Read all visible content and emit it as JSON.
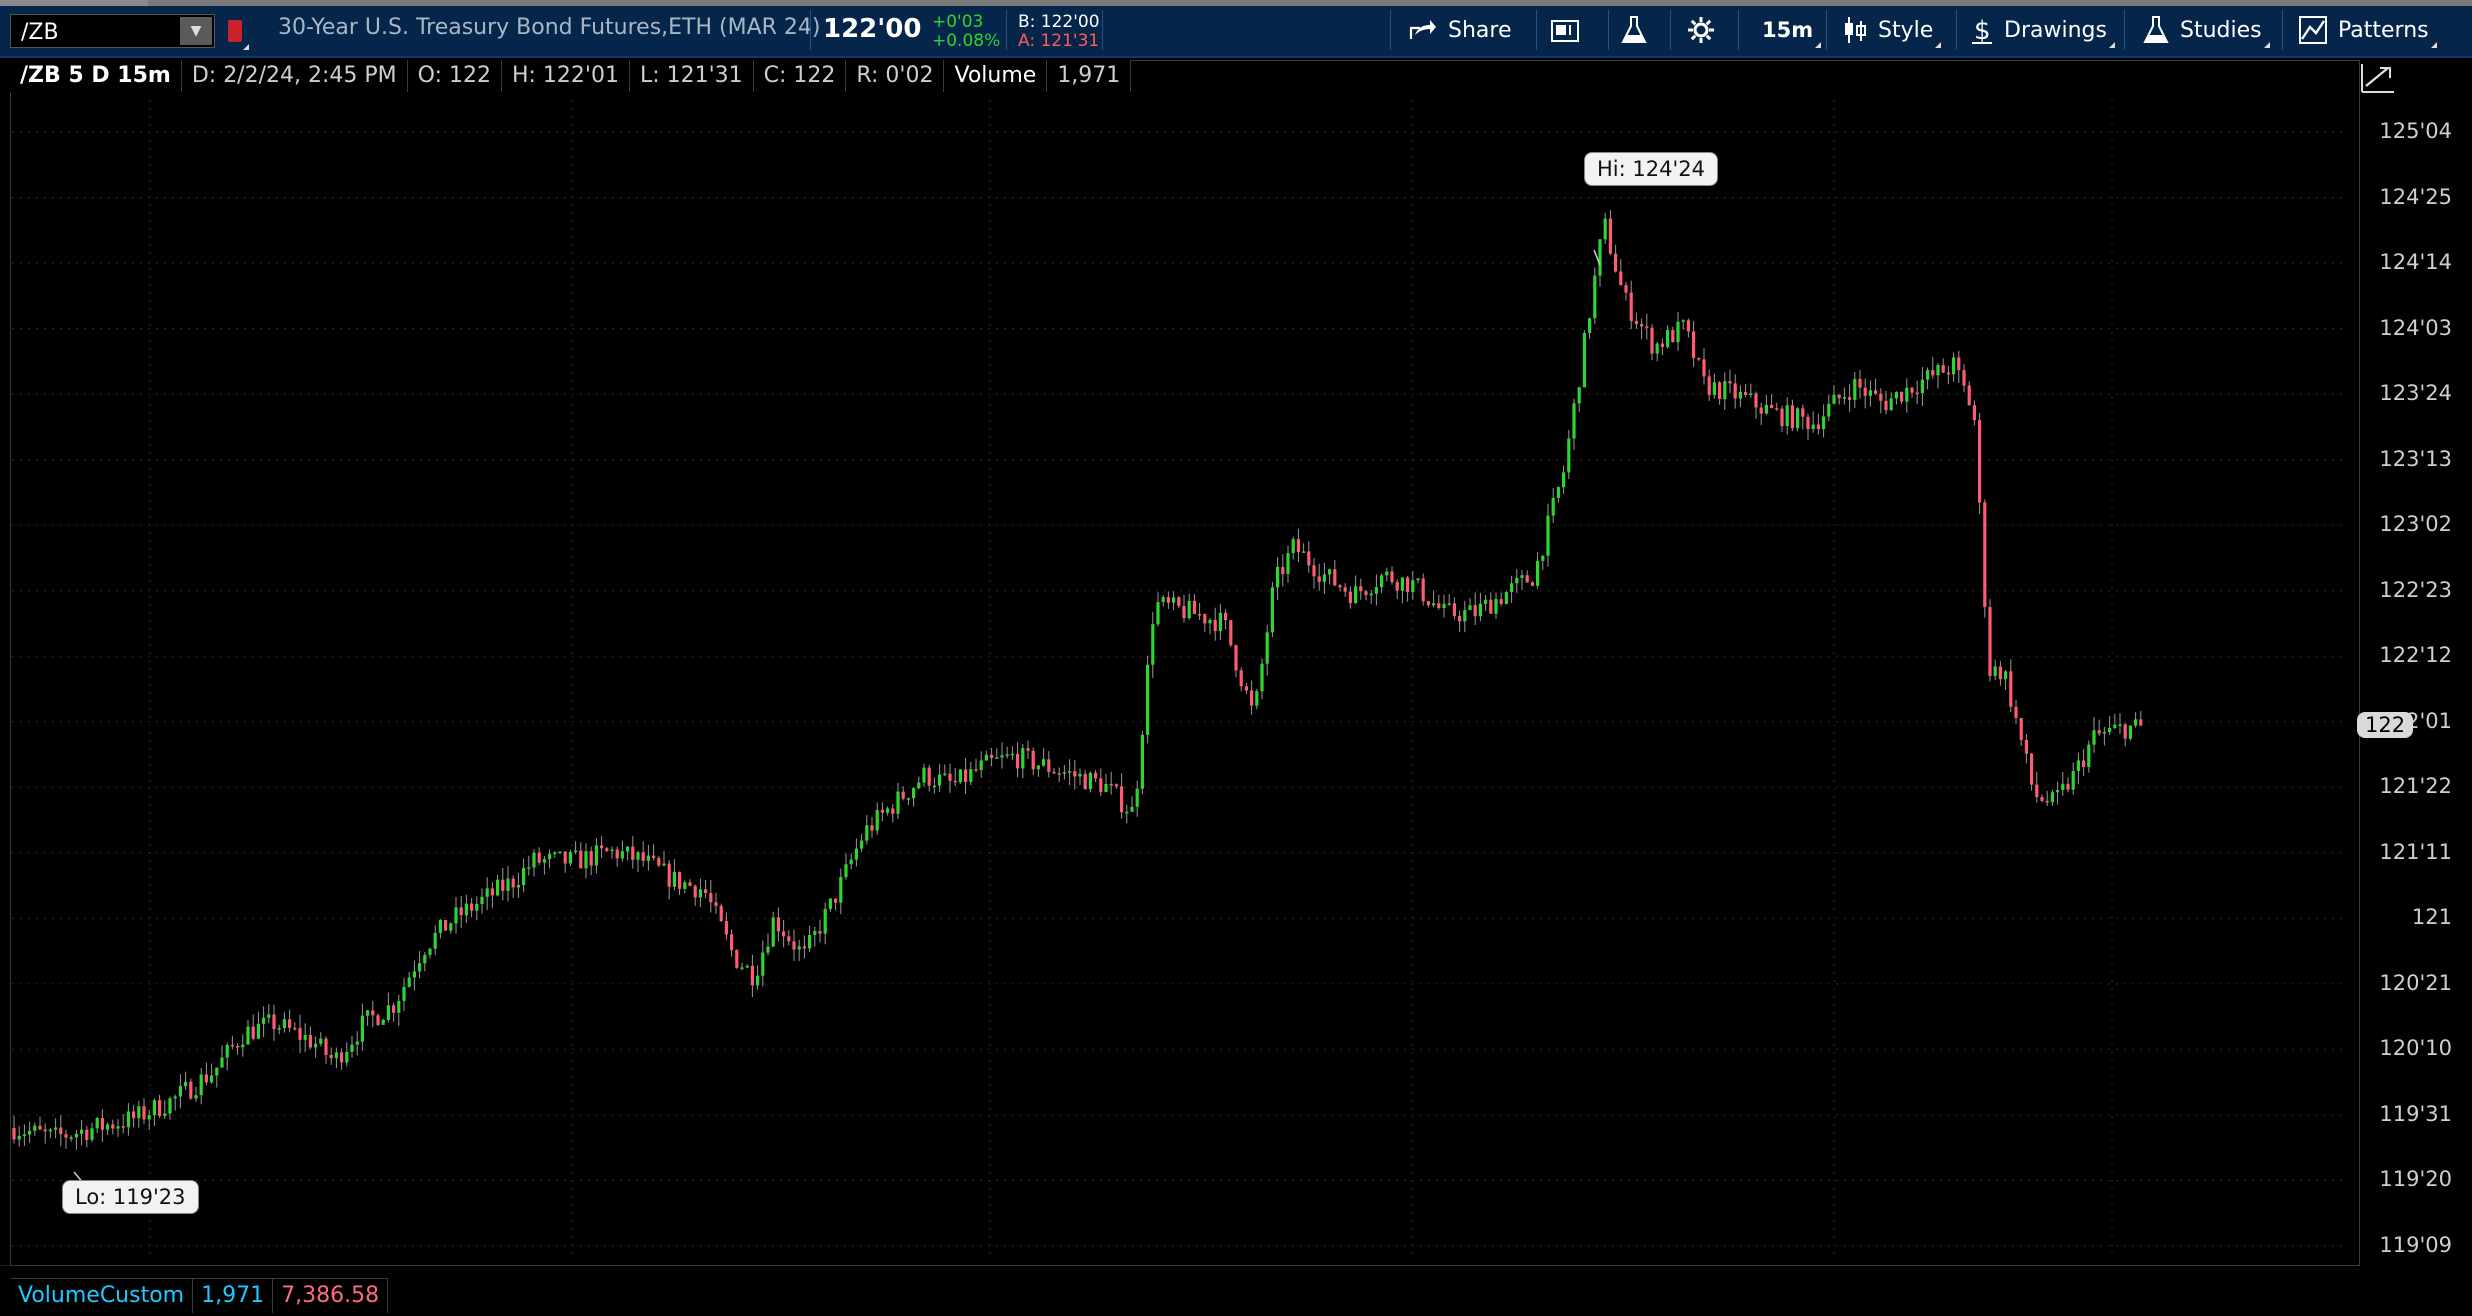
{
  "toolbar": {
    "symbol": "/ZB",
    "instrument": "30-Year U.S. Treasury Bond Futures,ETH (MAR 24)",
    "last_price": "122'00",
    "change_abs": "+0'03",
    "change_pct": "+0.08%",
    "bid": "B: 122'00",
    "ask": "A: 121'31",
    "share_label": "Share",
    "timeframe_label": "15m",
    "style_label": "Style",
    "drawings_label": "Drawings",
    "studies_label": "Studies",
    "patterns_label": "Patterns"
  },
  "chart_header": {
    "title": "/ZB 5 D 15m",
    "date": "D: 2/2/24, 2:45 PM",
    "open": "O: 122",
    "high": "H: 122'01",
    "low": "L: 121'31",
    "close": "C: 122",
    "range": "R: 0'02",
    "volume_label": "Volume",
    "volume_value": "1,971"
  },
  "callouts": {
    "high": "Hi: 124'24",
    "low": "Lo: 119'23"
  },
  "current_price_badge": "122",
  "volume_study": {
    "name": "VolumeCustom",
    "value1": "1,971",
    "value2": "7,386.58"
  },
  "colors": {
    "up": "#2ed52e",
    "down": "#ff5b72",
    "toolbar_bg": "#05264a",
    "accent_blue": "#1fc8ff"
  },
  "chart_data": {
    "type": "candlestick",
    "y_unit": "32nds of a point",
    "ylim": [
      119.22,
      125.1
    ],
    "y_ticks": [
      "125'04",
      "124'25",
      "124'14",
      "124'03",
      "123'24",
      "123'13",
      "123'02",
      "122'23",
      "122'12",
      "122'01",
      "121'22",
      "121'11",
      "121",
      "120'21",
      "120'10",
      "119'31",
      "119'20",
      "119'09"
    ],
    "high": 124.75,
    "low": 119.72,
    "last": 122.0,
    "path": [
      [
        0,
        119.9
      ],
      [
        40,
        119.85
      ],
      [
        80,
        119.9
      ],
      [
        120,
        119.95
      ],
      [
        160,
        120.05
      ],
      [
        200,
        120.2
      ],
      [
        230,
        120.4
      ],
      [
        260,
        120.45
      ],
      [
        300,
        120.35
      ],
      [
        320,
        120.25
      ],
      [
        350,
        120.45
      ],
      [
        380,
        120.55
      ],
      [
        410,
        120.85
      ],
      [
        440,
        121.0
      ],
      [
        470,
        121.1
      ],
      [
        500,
        121.2
      ],
      [
        520,
        121.3
      ],
      [
        560,
        121.3
      ],
      [
        600,
        121.35
      ],
      [
        630,
        121.3
      ],
      [
        660,
        121.2
      ],
      [
        690,
        121.15
      ],
      [
        720,
        120.8
      ],
      [
        740,
        120.7
      ],
      [
        760,
        121.0
      ],
      [
        790,
        120.8
      ],
      [
        820,
        121.1
      ],
      [
        850,
        121.45
      ],
      [
        880,
        121.6
      ],
      [
        910,
        121.75
      ],
      [
        940,
        121.7
      ],
      [
        970,
        121.8
      ],
      [
        1000,
        121.85
      ],
      [
        1030,
        121.8
      ],
      [
        1060,
        121.75
      ],
      [
        1090,
        121.7
      ],
      [
        1120,
        121.55
      ],
      [
        1140,
        122.65
      ],
      [
        1180,
        122.6
      ],
      [
        1210,
        122.55
      ],
      [
        1240,
        122.05
      ],
      [
        1260,
        122.75
      ],
      [
        1280,
        122.95
      ],
      [
        1310,
        122.8
      ],
      [
        1340,
        122.7
      ],
      [
        1370,
        122.8
      ],
      [
        1400,
        122.75
      ],
      [
        1430,
        122.6
      ],
      [
        1460,
        122.6
      ],
      [
        1490,
        122.7
      ],
      [
        1520,
        122.8
      ],
      [
        1550,
        123.35
      ],
      [
        1570,
        124.0
      ],
      [
        1590,
        124.65
      ],
      [
        1610,
        124.25
      ],
      [
        1640,
        124.0
      ],
      [
        1670,
        124.1
      ],
      [
        1690,
        123.8
      ],
      [
        1720,
        123.75
      ],
      [
        1760,
        123.65
      ],
      [
        1800,
        123.6
      ],
      [
        1840,
        123.8
      ],
      [
        1870,
        123.7
      ],
      [
        1900,
        123.8
      ],
      [
        1940,
        123.9
      ],
      [
        1960,
        123.65
      ],
      [
        1975,
        122.3
      ],
      [
        1990,
        122.3
      ],
      [
        2020,
        121.65
      ],
      [
        2040,
        121.6
      ],
      [
        2060,
        121.75
      ],
      [
        2080,
        121.95
      ],
      [
        2110,
        122.0
      ],
      [
        2130,
        122.0
      ]
    ]
  }
}
